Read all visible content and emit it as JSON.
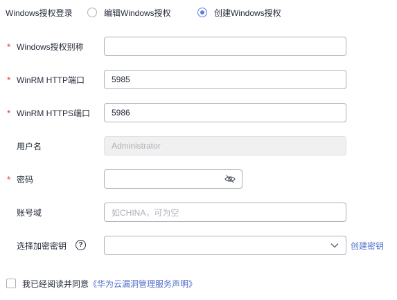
{
  "auth_mode": {
    "label": "Windows授权登录",
    "option_edit": "编辑Windows授权",
    "option_create": "创建Windows授权",
    "selected": "create"
  },
  "fields": {
    "alias": {
      "label": "Windows授权别称",
      "value": ""
    },
    "http_port": {
      "label": "WinRM HTTP端口",
      "value": "5985"
    },
    "https_port": {
      "label": "WinRM HTTPS端口",
      "value": "5986"
    },
    "username": {
      "label": "用户名",
      "value": "Administrator"
    },
    "password": {
      "label": "密码",
      "value": ""
    },
    "domain": {
      "label": "账号域",
      "placeholder": "如CHINA，可为空"
    },
    "key": {
      "label": "选择加密密钥",
      "value": "",
      "create_link": "创建密钥"
    }
  },
  "agreement": {
    "text": "我已经阅读并同意",
    "link": "《华为云漏洞管理服务声明》"
  },
  "colors": {
    "required": "#e54545",
    "accent": "#5e7ce0",
    "link": "#526ecc"
  },
  "icons": {
    "password_toggle": "eye-off-icon",
    "select_arrow": "chevron-down-icon",
    "help": "question-circle-icon"
  }
}
